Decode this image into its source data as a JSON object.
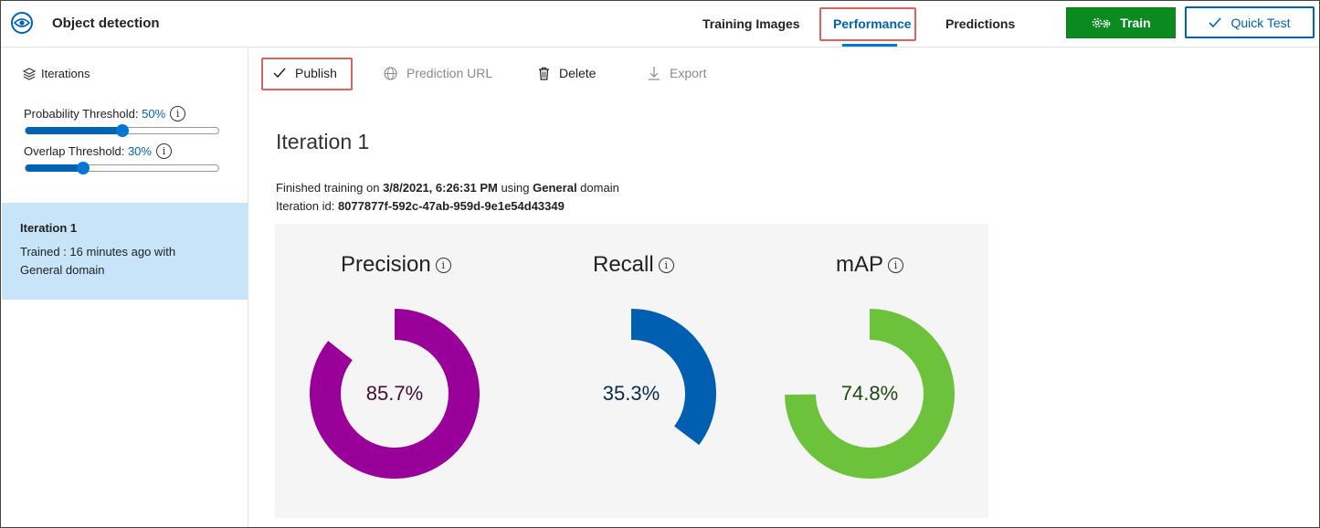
{
  "header": {
    "app_title": "Object detection",
    "tabs": [
      {
        "label": "Training Images"
      },
      {
        "label": "Performance",
        "active": true
      },
      {
        "label": "Predictions"
      }
    ],
    "train_label": "Train",
    "quick_test_label": "Quick Test",
    "colors": {
      "accent": "#0063b1",
      "train": "#0b8a1f",
      "highlight": "#e06060"
    }
  },
  "sidebar": {
    "heading": "Iterations",
    "probability": {
      "label": "Probability Threshold:",
      "value": "50%",
      "level": 0.5
    },
    "overlap": {
      "label": "Overlap Threshold:",
      "value": "30%",
      "level": 0.3
    },
    "iteration_card": {
      "title": "Iteration 1",
      "text": "Trained : 16 minutes ago with General domain"
    }
  },
  "toolbar": {
    "publish": "Publish",
    "prediction_url": "Prediction URL",
    "delete": "Delete",
    "export": "Export"
  },
  "main": {
    "title": "Iteration 1",
    "finished_prefix": "Finished training on ",
    "finished_date": "3/8/2021, 6:26:31 PM",
    "finished_mid": " using ",
    "finished_domain": "General",
    "finished_suffix": " domain",
    "iteration_id_label": "Iteration id: ",
    "iteration_id": "8077877f-592c-47ab-959d-9e1e54d43349"
  },
  "metrics": [
    {
      "name": "Precision",
      "value_text": "85.7%",
      "value": 85.7,
      "color": "#990099",
      "label_color": "#4a0a3a"
    },
    {
      "name": "Recall",
      "value_text": "35.3%",
      "value": 35.3,
      "color": "#005fb0",
      "label_color": "#0b2a4a"
    },
    {
      "name": "mAP",
      "value_text": "74.8%",
      "value": 74.8,
      "color": "#6cc23a",
      "label_color": "#1f4a10"
    }
  ]
}
